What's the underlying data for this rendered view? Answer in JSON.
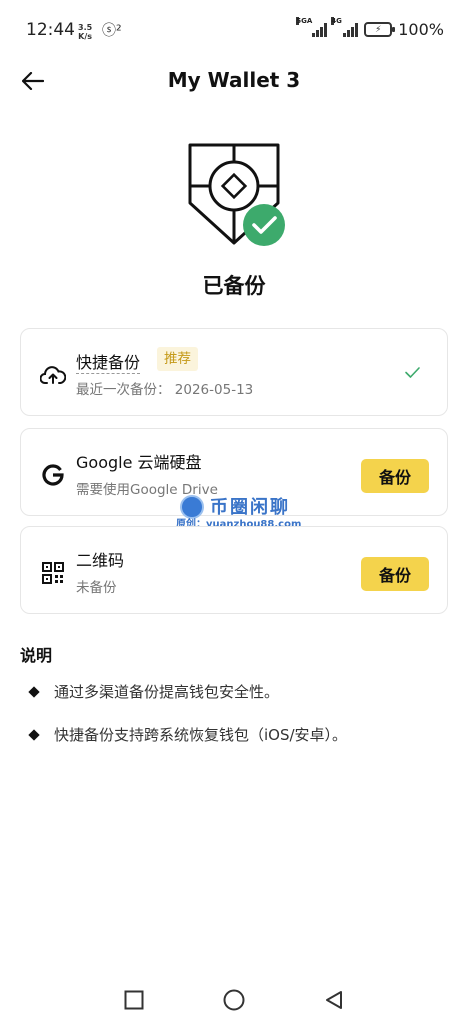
{
  "status_bar": {
    "time": "12:44",
    "net_speed_value": "3.5",
    "net_speed_unit": "K/s",
    "extra_icon_text": "ⓢ²",
    "signal1_label": "5GA",
    "signal2_label": "4G",
    "battery_text": "100%"
  },
  "header": {
    "title": "My Wallet 3",
    "back_icon": "arrow-left-icon"
  },
  "backup": {
    "status_label": "已备份",
    "shield_icon": "shield-check-icon",
    "check_color": "#3daa6c"
  },
  "options": [
    {
      "title": "快捷备份",
      "badge": "推荐",
      "subtitle": "最近一次备份： 2026-05-13",
      "icon": "cloud-upload-icon",
      "status_icon": "checkmark-icon"
    },
    {
      "title": "Google 云端硬盘",
      "subtitle": "需要使用Google Drive",
      "icon": "google-g-icon",
      "action_label": "备份"
    },
    {
      "title": "二维码",
      "subtitle": "未备份",
      "icon": "qr-code-icon",
      "action_label": "备份"
    }
  ],
  "watermark": {
    "brand": "币圈闲聊",
    "url": "原创：yuanzhou88.com"
  },
  "notes": {
    "title": "说明",
    "items": [
      "通过多渠道备份提高钱包安全性。",
      "快捷备份支持跨系统恢复钱包（iOS/安卓）。"
    ]
  },
  "nav_bar": {
    "recent_icon": "square-icon",
    "home_icon": "circle-icon",
    "back_icon": "triangle-back-icon"
  },
  "colors": {
    "accent_yellow": "#f4d34c",
    "badge_bg": "#fbf4dc",
    "badge_text": "#c59a19",
    "success_green": "#3daa6c"
  }
}
